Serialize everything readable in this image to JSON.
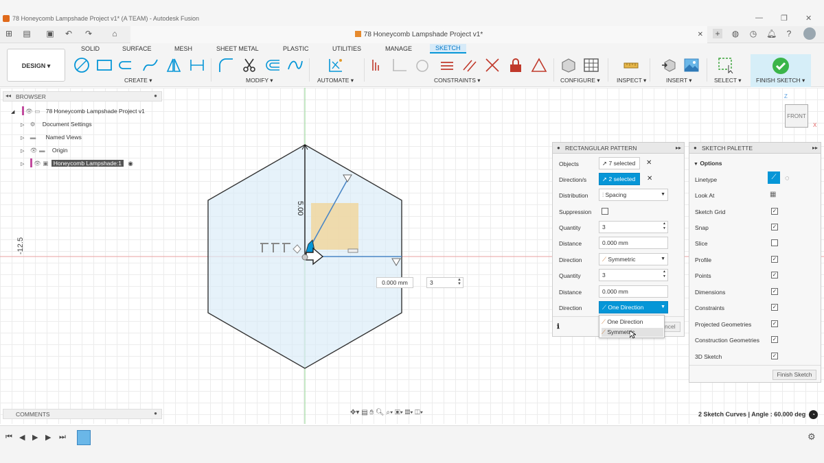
{
  "window": {
    "title": "78 Honeycomb Lampshade Project v1* (A TEAM) - Autodesk Fusion",
    "doc_tab": "78 Honeycomb Lampshade Project v1*"
  },
  "toolbar": {
    "design_label": "DESIGN ▾",
    "tabs": [
      "SOLID",
      "SURFACE",
      "MESH",
      "SHEET METAL",
      "PLASTIC",
      "UTILITIES",
      "MANAGE",
      "SKETCH"
    ],
    "groups": {
      "create": "CREATE ▾",
      "modify": "MODIFY ▾",
      "automate": "AUTOMATE ▾",
      "constraints": "CONSTRAINTS ▾",
      "configure": "CONFIGURE ▾",
      "inspect": "INSPECT ▾",
      "insert": "INSERT ▾",
      "select": "SELECT ▾",
      "finish": "FINISH SKETCH ▾"
    },
    "accent": "#0696d7"
  },
  "browser": {
    "title": "BROWSER",
    "items": [
      {
        "label": "78 Honeycomb Lampshade Project v1"
      },
      {
        "label": "Document Settings"
      },
      {
        "label": "Named Views"
      },
      {
        "label": "Origin"
      },
      {
        "label": "Honeycomb Lampshade:1"
      }
    ]
  },
  "canvas": {
    "dim_vertical": "5.00",
    "dim_side": "-12.5",
    "inline_distance": "0.000 mm",
    "inline_quantity": "3",
    "viewcube_label": "FRONT",
    "axis_z": "Z",
    "axis_x": "X"
  },
  "pattern_panel": {
    "title": "RECTANGULAR PATTERN",
    "rows": {
      "objects_label": "Objects",
      "objects_value": "7 selected",
      "directions_label": "Direction/s",
      "directions_value": "2 selected",
      "distribution_label": "Distribution",
      "distribution_value": "Spacing",
      "suppression_label": "Suppression",
      "quantity1_label": "Quantity",
      "quantity1_value": "3",
      "distance1_label": "Distance",
      "distance1_value": "0.000 mm",
      "direction1_label": "Direction",
      "direction1_value": "Symmetric",
      "quantity2_label": "Quantity",
      "quantity2_value": "3",
      "distance2_label": "Distance",
      "distance2_value": "0.000 mm",
      "direction2_label": "Direction",
      "direction2_value": "One Direction"
    },
    "dropdown_options": [
      "One Direction",
      "Symmetric"
    ],
    "cancel_fragment": "ncel"
  },
  "sketch_palette": {
    "title": "SKETCH PALETTE",
    "section": "Options",
    "options": [
      {
        "label": "Linetype",
        "type": "icon"
      },
      {
        "label": "Look At",
        "type": "icon"
      },
      {
        "label": "Sketch Grid",
        "checked": true
      },
      {
        "label": "Snap",
        "checked": true
      },
      {
        "label": "Slice",
        "checked": false
      },
      {
        "label": "Profile",
        "checked": true
      },
      {
        "label": "Points",
        "checked": true
      },
      {
        "label": "Dimensions",
        "checked": true
      },
      {
        "label": "Constraints",
        "checked": true
      },
      {
        "label": "Projected Geometries",
        "checked": true
      },
      {
        "label": "Construction Geometries",
        "checked": true
      },
      {
        "label": "3D Sketch",
        "checked": true
      }
    ],
    "finish_button": "Finish Sketch"
  },
  "comments": {
    "title": "COMMENTS"
  },
  "status": {
    "text": "2 Sketch Curves | Angle : 60.000 deg"
  }
}
